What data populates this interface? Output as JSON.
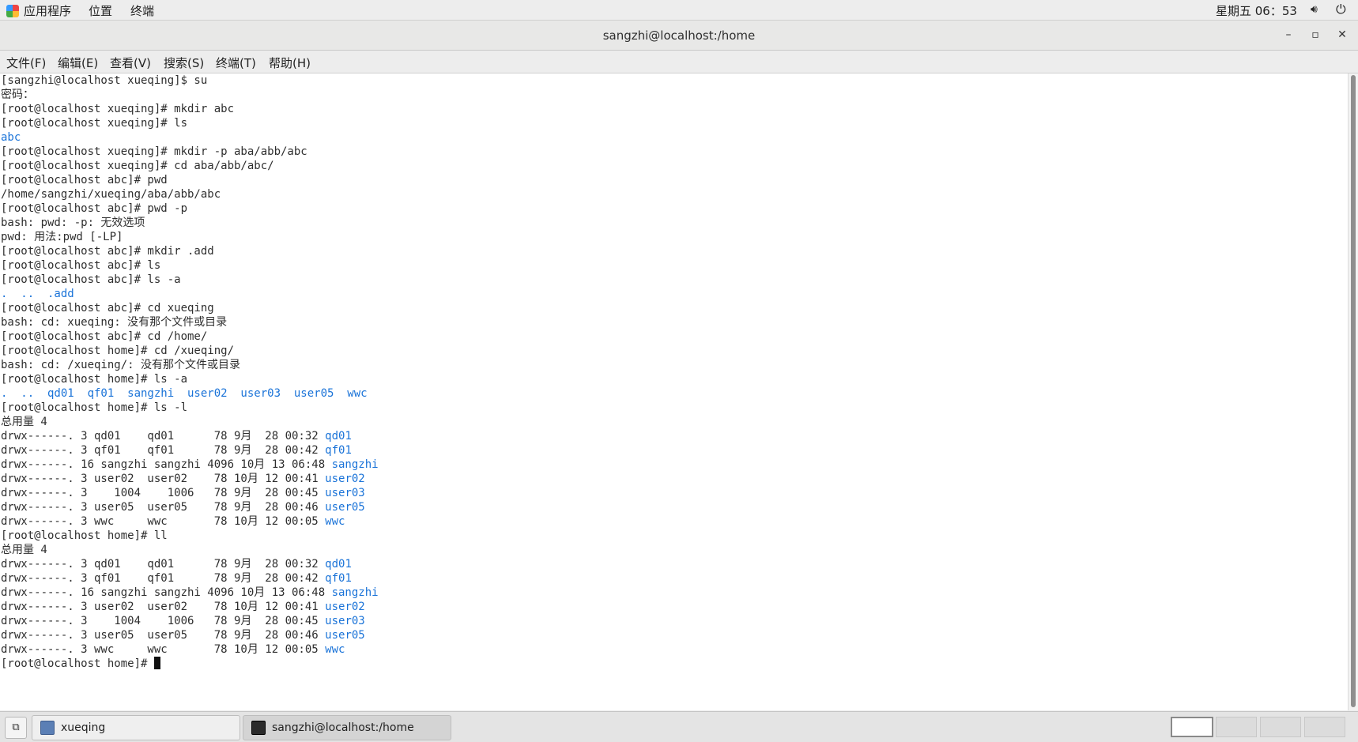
{
  "top_panel": {
    "applications": "应用程序",
    "places": "位置",
    "terminal": "终端",
    "clock": "星期五 06：53"
  },
  "window": {
    "title": "sangzhi@localhost:/home",
    "minimize": "–",
    "maximize": "▫",
    "close": "✕"
  },
  "menubar": {
    "file": "文件(F)",
    "edit": "编辑(E)",
    "view": "查看(V)",
    "search": "搜索(S)",
    "terminal": "终端(T)",
    "help": "帮助(H)"
  },
  "terminal_lines": [
    [
      {
        "t": "[sangzhi@localhost xueqing]$ su"
      }
    ],
    [
      {
        "t": "密码："
      }
    ],
    [
      {
        "t": "[root@localhost xueqing]# mkdir abc"
      }
    ],
    [
      {
        "t": "[root@localhost xueqing]# ls"
      }
    ],
    [
      {
        "t": "abc",
        "hl": true
      }
    ],
    [
      {
        "t": "[root@localhost xueqing]# mkdir -p aba/abb/abc"
      }
    ],
    [
      {
        "t": "[root@localhost xueqing]# cd aba/abb/abc/"
      }
    ],
    [
      {
        "t": "[root@localhost abc]# pwd"
      }
    ],
    [
      {
        "t": "/home/sangzhi/xueqing/aba/abb/abc"
      }
    ],
    [
      {
        "t": "[root@localhost abc]# pwd -p"
      }
    ],
    [
      {
        "t": "bash: pwd: -p: 无效选项"
      }
    ],
    [
      {
        "t": "pwd: 用法:pwd [-LP]"
      }
    ],
    [
      {
        "t": "[root@localhost abc]# mkdir .add"
      }
    ],
    [
      {
        "t": "[root@localhost abc]# ls"
      }
    ],
    [
      {
        "t": "[root@localhost abc]# ls -a"
      }
    ],
    [
      {
        "t": ".  ..  .add",
        "hl": true
      }
    ],
    [
      {
        "t": "[root@localhost abc]# cd xueqing"
      }
    ],
    [
      {
        "t": "bash: cd: xueqing: 没有那个文件或目录"
      }
    ],
    [
      {
        "t": "[root@localhost abc]# cd /home/"
      }
    ],
    [
      {
        "t": "[root@localhost home]# cd /xueqing/"
      }
    ],
    [
      {
        "t": "bash: cd: /xueqing/: 没有那个文件或目录"
      }
    ],
    [
      {
        "t": "[root@localhost home]# ls -a"
      }
    ],
    [
      {
        "t": ".  ..  qd01  qf01  sangzhi  user02  user03  user05  wwc",
        "hl": true
      }
    ],
    [
      {
        "t": "[root@localhost home]# ls -l"
      }
    ],
    [
      {
        "t": "总用量 4"
      }
    ],
    [
      {
        "t": "drwx------. 3 qd01    qd01      78 9月  28 00:32 "
      },
      {
        "t": "qd01",
        "hl": true
      }
    ],
    [
      {
        "t": "drwx------. 3 qf01    qf01      78 9月  28 00:42 "
      },
      {
        "t": "qf01",
        "hl": true
      }
    ],
    [
      {
        "t": "drwx------. 16 sangzhi sangzhi 4096 10月 13 06:48 "
      },
      {
        "t": "sangzhi",
        "hl": true
      }
    ],
    [
      {
        "t": "drwx------. 3 user02  user02    78 10月 12 00:41 "
      },
      {
        "t": "user02",
        "hl": true
      }
    ],
    [
      {
        "t": "drwx------. 3    1004    1006   78 9月  28 00:45 "
      },
      {
        "t": "user03",
        "hl": true
      }
    ],
    [
      {
        "t": "drwx------. 3 user05  user05    78 9月  28 00:46 "
      },
      {
        "t": "user05",
        "hl": true
      }
    ],
    [
      {
        "t": "drwx------. 3 wwc     wwc       78 10月 12 00:05 "
      },
      {
        "t": "wwc",
        "hl": true
      }
    ],
    [
      {
        "t": "[root@localhost home]# ll"
      }
    ],
    [
      {
        "t": "总用量 4"
      }
    ],
    [
      {
        "t": "drwx------. 3 qd01    qd01      78 9月  28 00:32 "
      },
      {
        "t": "qd01",
        "hl": true
      }
    ],
    [
      {
        "t": "drwx------. 3 qf01    qf01      78 9月  28 00:42 "
      },
      {
        "t": "qf01",
        "hl": true
      }
    ],
    [
      {
        "t": "drwx------. 16 sangzhi sangzhi 4096 10月 13 06:48 "
      },
      {
        "t": "sangzhi",
        "hl": true
      }
    ],
    [
      {
        "t": "drwx------. 3 user02  user02    78 10月 12 00:41 "
      },
      {
        "t": "user02",
        "hl": true
      }
    ],
    [
      {
        "t": "drwx------. 3    1004    1006   78 9月  28 00:45 "
      },
      {
        "t": "user03",
        "hl": true
      }
    ],
    [
      {
        "t": "drwx------. 3 user05  user05    78 9月  28 00:46 "
      },
      {
        "t": "user05",
        "hl": true
      }
    ],
    [
      {
        "t": "drwx------. 3 wwc     wwc       78 10月 12 00:05 "
      },
      {
        "t": "wwc",
        "hl": true
      }
    ],
    [
      {
        "t": "[root@localhost home]# "
      }
    ]
  ],
  "taskbar": {
    "tasks": [
      "xueqing",
      "sangzhi@localhost:/home"
    ],
    "workspaces": 4,
    "active_workspace": 1
  },
  "colors": {
    "link_blue": "#1a73d8",
    "text": "#2e2e2e",
    "terminal_bg": "#ffffff"
  },
  "icons": [
    "applications-icon",
    "volume-icon",
    "power-icon",
    "minimize-icon",
    "maximize-icon",
    "close-icon",
    "show-desktop-icon",
    "folder-icon",
    "terminal-icon"
  ]
}
